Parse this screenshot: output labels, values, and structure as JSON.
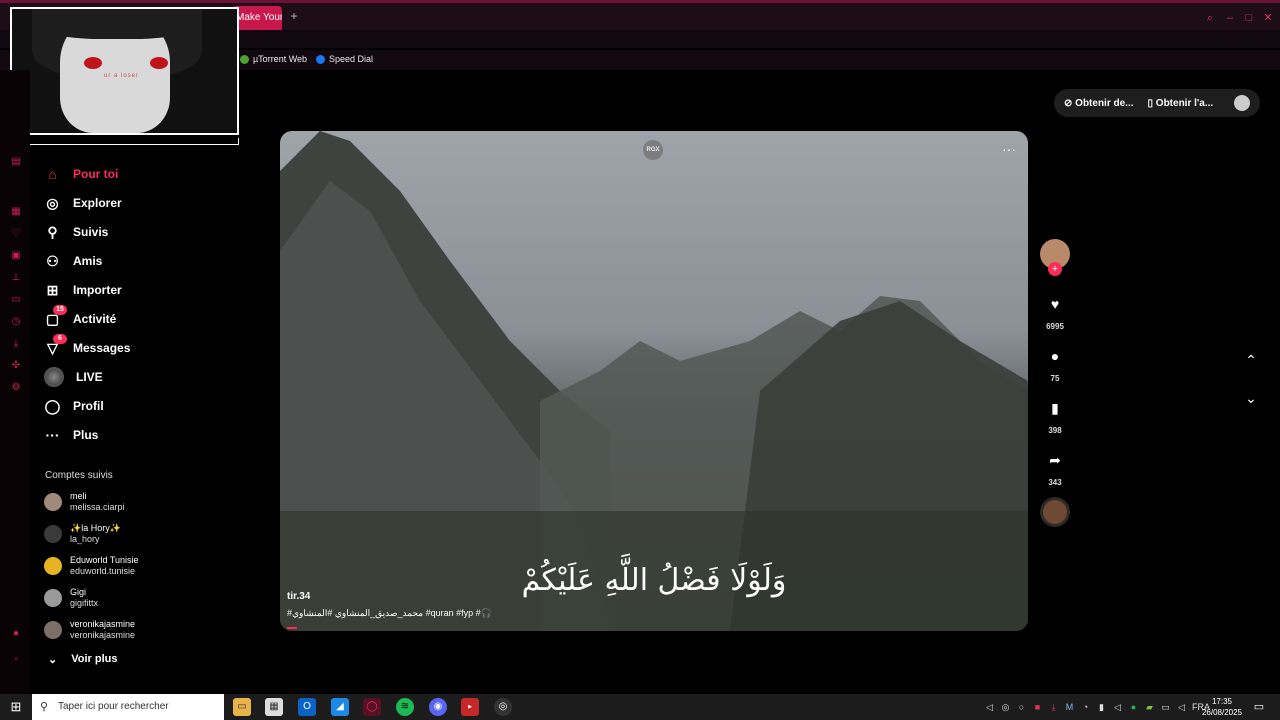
{
  "browser": {
    "tab_title": "Make Your D...",
    "new_tab": "+",
    "bookmarks": [
      {
        "label": "µTorrent Web",
        "icon": "utorrent-icon",
        "color": "#4aa52c"
      },
      {
        "label": "Speed Dial",
        "icon": "speed-dial-icon",
        "color": "#1877f2"
      }
    ]
  },
  "webcam": {
    "caption": "ur a loser"
  },
  "nav": {
    "items": [
      {
        "label": "Pour toi",
        "icon": "home-icon",
        "glyph": "⌂",
        "active": true
      },
      {
        "label": "Explorer",
        "icon": "compass-icon",
        "glyph": "◎"
      },
      {
        "label": "Suivis",
        "icon": "following-icon",
        "glyph": "👤"
      },
      {
        "label": "Amis",
        "icon": "friends-icon",
        "glyph": "👥"
      },
      {
        "label": "Importer",
        "icon": "upload-icon",
        "glyph": "⊞"
      },
      {
        "label": "Activité",
        "icon": "activity-icon",
        "glyph": "▢",
        "badge": "15"
      },
      {
        "label": "Messages",
        "icon": "messages-icon",
        "glyph": "▽",
        "badge": "6"
      },
      {
        "label": "LIVE",
        "icon": "live-avatar-icon",
        "glyph": ""
      },
      {
        "label": "Profil",
        "icon": "profile-icon",
        "glyph": "◯"
      },
      {
        "label": "Plus",
        "icon": "more-icon",
        "glyph": "···"
      }
    ],
    "following_title": "Comptes suivis",
    "accounts": [
      {
        "name": "meli",
        "handle": "melissa.ciarpi"
      },
      {
        "name": "✨la Hory✨",
        "handle": "la_hory"
      },
      {
        "name": "Eduworld Tunisie",
        "handle": "eduworld.tunisie"
      },
      {
        "name": "Gigi",
        "handle": "gigifittx"
      },
      {
        "name": "veronikajasmine",
        "handle": "veronikajasmine"
      }
    ],
    "see_more": "Voir plus"
  },
  "top_buttons": {
    "get_coins": "Obtenir de...",
    "get_app": "Obtenir l'a..."
  },
  "video": {
    "brand": "RGX",
    "arabic_caption": "وَلَوْلَا فَضْلُ اللَّهِ عَلَيْكُمْ",
    "author": "tir.34",
    "hashtags": "#محمد_صديق_المنشاوي #المنشاوي #quran #fyp #🎧"
  },
  "actions": {
    "likes": "6995",
    "comments": "75",
    "saves": "398",
    "shares": "343"
  },
  "taskbar": {
    "search_placeholder": "Taper ici pour rechercher",
    "language": "FRA",
    "time": "17:35",
    "date": "26/08/2025"
  },
  "colors": {
    "accent": "#fe2c55",
    "tab_active": "#c8174c",
    "browser_frame": "#1c0d16"
  }
}
